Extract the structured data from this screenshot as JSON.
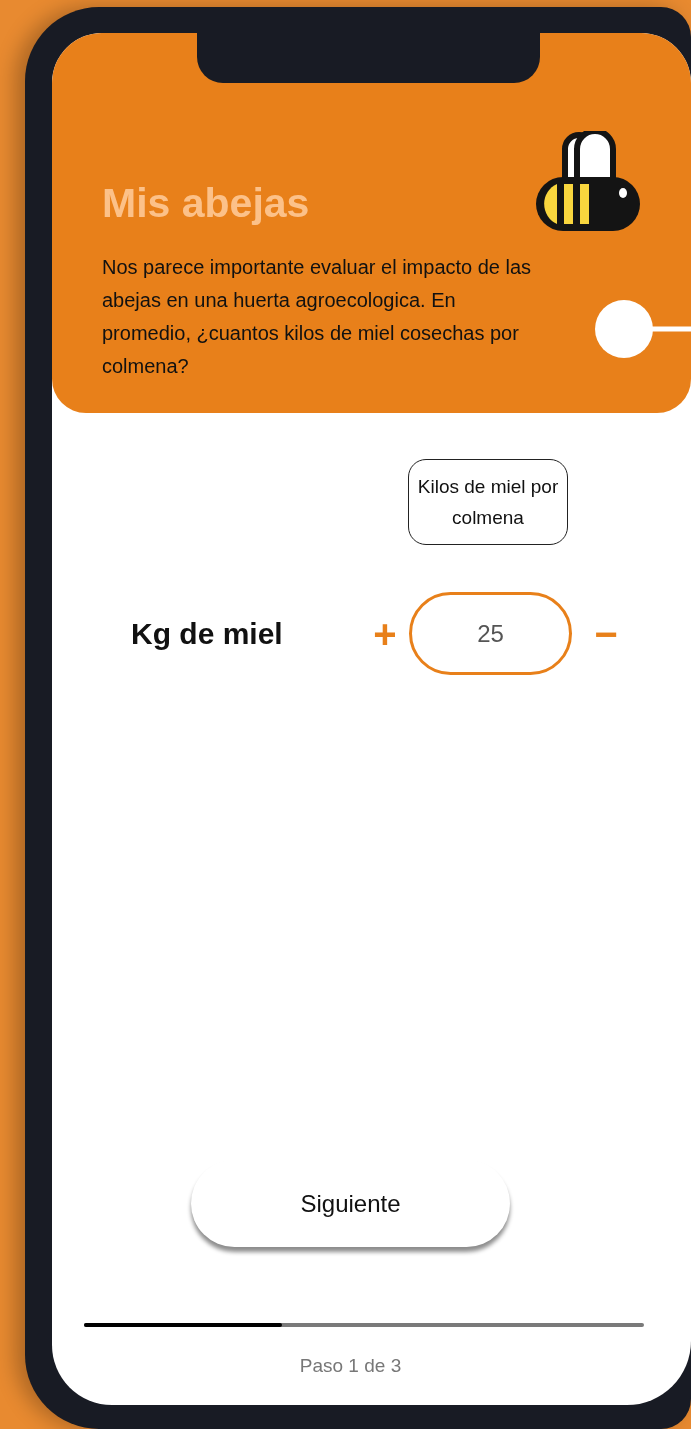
{
  "header": {
    "title": "Mis abejas",
    "description": "Nos parece importante evaluar el impacto de las abejas en una huerta agroecologica. En promedio, ¿cuantos kilos de miel cosechas por colmena?"
  },
  "tooltip": "Kilos de miel por colmena",
  "stepper": {
    "label": "Kg de miel",
    "increment": "+",
    "value": "25",
    "decrement": "−"
  },
  "next_button": "Siguiente",
  "progress": {
    "level": 0.354,
    "caption": "Paso 1 de 3"
  }
}
